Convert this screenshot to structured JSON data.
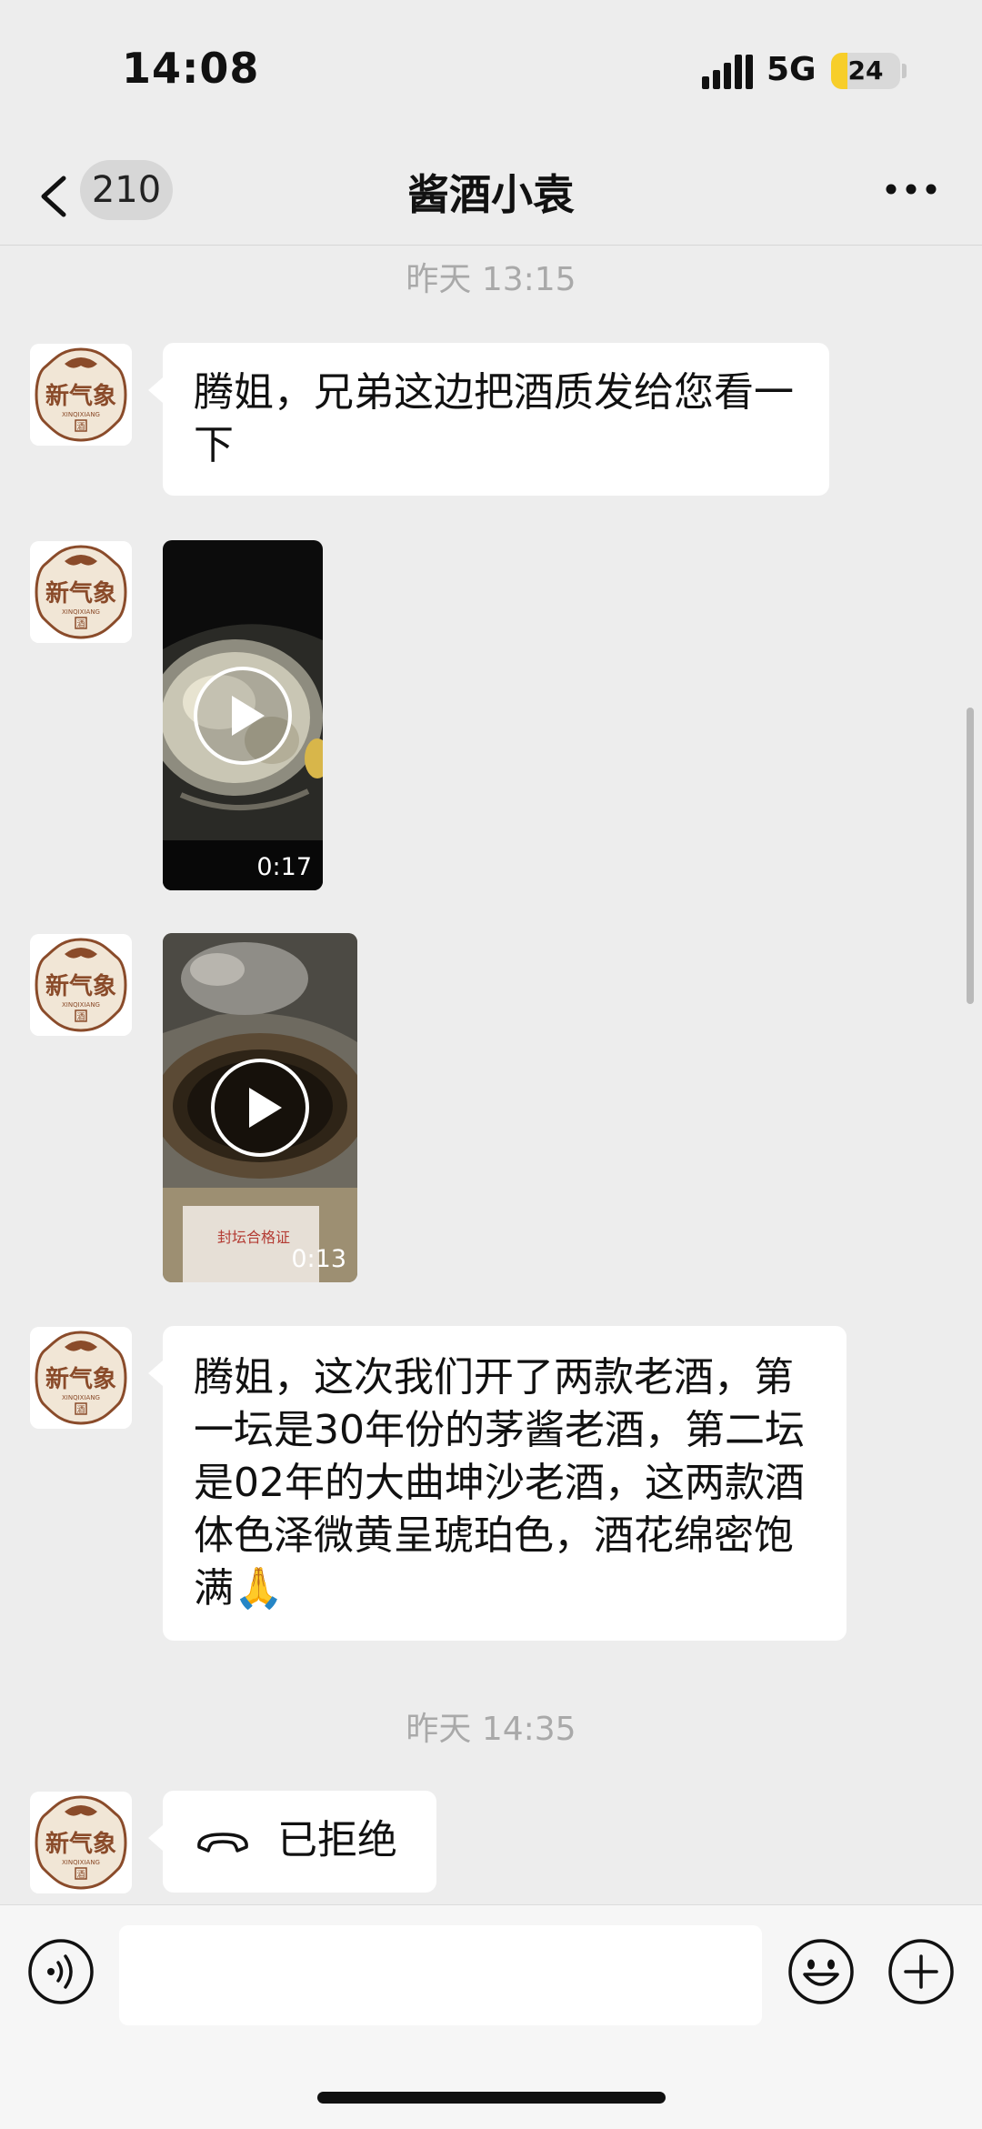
{
  "status_bar": {
    "time": "14:08",
    "network": "5G",
    "battery": "24",
    "battery_level_percent": 24,
    "battery_color": "#F7CE2A"
  },
  "nav": {
    "unread_count": "210",
    "title": "酱酒小袁"
  },
  "contact": {
    "avatar_text_main": "新气象",
    "avatar_text_sub": "XINQIXIANG",
    "avatar_seal": "酒",
    "avatar_color": "#8A4B2A"
  },
  "messages": {
    "ts1": "昨天 13:15",
    "msg1": "腾姐，兄弟这边把酒质发给您看一下",
    "video1_duration": "0:17",
    "video2_duration": "0:13",
    "video2_label": "封坛合格证",
    "msg2": "腾姐，这次我们开了两款老酒，第一坛是30年份的茅酱老酒，第二坛是02年的大曲坤沙老酒，这两款酒体色泽微黄呈琥珀色，酒花绵密饱满",
    "msg2_emoji": "🙏",
    "ts2": "昨天 14:35",
    "call_status": "已拒绝"
  },
  "colors": {
    "background": "#EDEDED",
    "bubble": "#FFFFFF",
    "timestamp": "#A9A9A9"
  },
  "icons": {
    "back": "chevron-left",
    "more": "ellipsis-horizontal",
    "voice": "voice-wave",
    "emoji": "smiley",
    "plus": "plus-circle",
    "call": "hang-up-phone",
    "play": "play-circle"
  }
}
